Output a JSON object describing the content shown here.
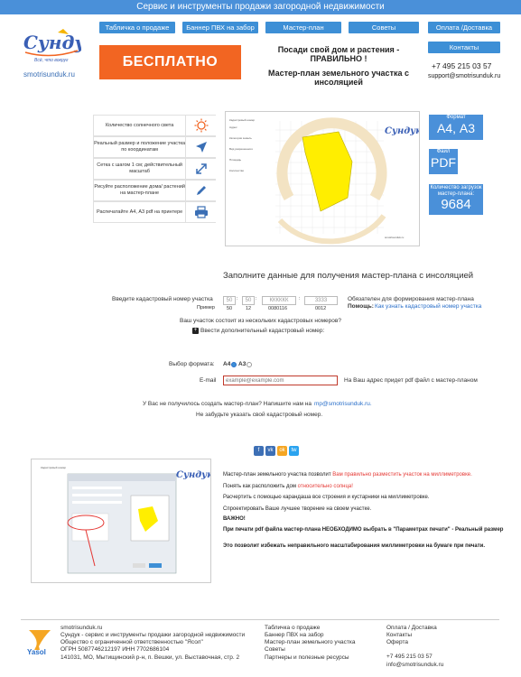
{
  "header": {
    "title": "Сервис и инструменты продажи загородной недвижимости",
    "nav": [
      "Табличка о продаже",
      "Баннер ПВХ на забор",
      "Мастер-план",
      "Советы",
      "Оплата /Доставка",
      "Контакты"
    ],
    "logo_slogan": "Всё, что вокруг",
    "site_url": "smotrisunduk.ru",
    "free_label": "БЕСПЛАТНО",
    "headline1": "Посади свой дом и растения - ПРАВИЛЬНО !",
    "headline2": "Мастер-план земельного участка с инсоляцией",
    "phone": "+7 495 215 03 57",
    "email": "support@smotrisunduk.ru"
  },
  "features": [
    {
      "label": "Количество солнечного света",
      "icon": "sun-icon"
    },
    {
      "label": "Реальный размер и положение участка по координатам",
      "icon": "navigation-arrow-icon"
    },
    {
      "label": "Сетка с шагом 1 см; действительный масштаб",
      "icon": "resize-arrows-icon"
    },
    {
      "label": "Рисуйте расположение дома/ растений на мастер-плане",
      "icon": "pencil-icon"
    },
    {
      "label": "Распечатайте А4, А3 pdf на принтере",
      "icon": "printer-icon"
    }
  ],
  "badges": {
    "format_label": "Формат",
    "format_value": "А4, А3",
    "file_label": "Файл",
    "file_value": "PDF",
    "downloads_label": "Количество загрузок мастер-плана:",
    "downloads_value": "9684"
  },
  "form": {
    "title": "Заполните данные для получения мастер-плана с инсоляцией",
    "cad_label": "Введите кадастровый номер участка",
    "cad_placeholders": [
      "50",
      "50",
      "КККККК",
      "3333"
    ],
    "example_label": "Пример",
    "example_values": [
      "50",
      "12",
      "0080116",
      "0012"
    ],
    "cad_required": "Обязателен для формирования мастер-плана",
    "help_label": "Помощь:",
    "help_link": "Как узнать кадастровый номер участка",
    "multi_question": "Ваш участок состоит из нескольких кадастровых номеров?",
    "add_more": "Ввести дополнительный кадастровый номер:",
    "format_label": "Выбор формата:",
    "format_a4": "A4",
    "format_a3": "A3",
    "email_label": "E-mail",
    "email_placeholder": "example@example.com",
    "email_note": "На Ваш адрес придет pdf файл с мастер-планом",
    "fail_text": "У Вас не получилось создать мастер-план? Напишите нам на",
    "fail_email": "mp@smotrisunduk.ru.",
    "reminder": "Не забудьте указать свой кадастровый номер."
  },
  "social": [
    "f",
    "vk",
    "ok",
    "tw"
  ],
  "info": {
    "p1_a": "Мастер-план земельного участка позволит",
    "p1_b": "Вам правильно разместить участок на миллиметровке.",
    "p2_a": "Понять как расположить дом",
    "p2_b": "относительно солнца!",
    "p3": "Расчертить с помощью карандаша все строения и кустарники на миллиметровке.",
    "p4": "Спроектировать Ваше лучшее творение на своем участке.",
    "important": "ВАЖНО!",
    "p5": "При печати pdf файла мастер-плана НЕОБХОДИМО выбрать в \"Параметрах печати\" - Реальный размер",
    "p6": "Это позволит избежать неправильного масштабирования миллиметровки на бумаге при печати."
  },
  "footer": {
    "col1": [
      "smotrisunduk.ru",
      "Сундук - сервис и инструменты продажи загородной недвижимости",
      "Общество с ограниченной ответственностью \"Ясол\"",
      "ОГРН 5087746212197 ИНН 7702686104",
      "141031, МО, Мытищинский р-н, п. Вешки, ул. Выставочная, стр. 2"
    ],
    "col2": [
      "Табличка о продаже",
      "Баннер ПВХ на забор",
      "Мастер-план земельного участка",
      "Советы",
      "Партнеры и полезные ресурсы"
    ],
    "col3": [
      "Оплата / Доставка",
      "Контакты",
      "Оферта",
      "",
      "+7 495 215 03 57",
      "info@smotrisunduk.ru"
    ],
    "yasol": "Yasol"
  },
  "colors": {
    "blue": "#4a90d9",
    "orange": "#f26522",
    "red": "#e53935",
    "yellow": "#ffee00"
  }
}
